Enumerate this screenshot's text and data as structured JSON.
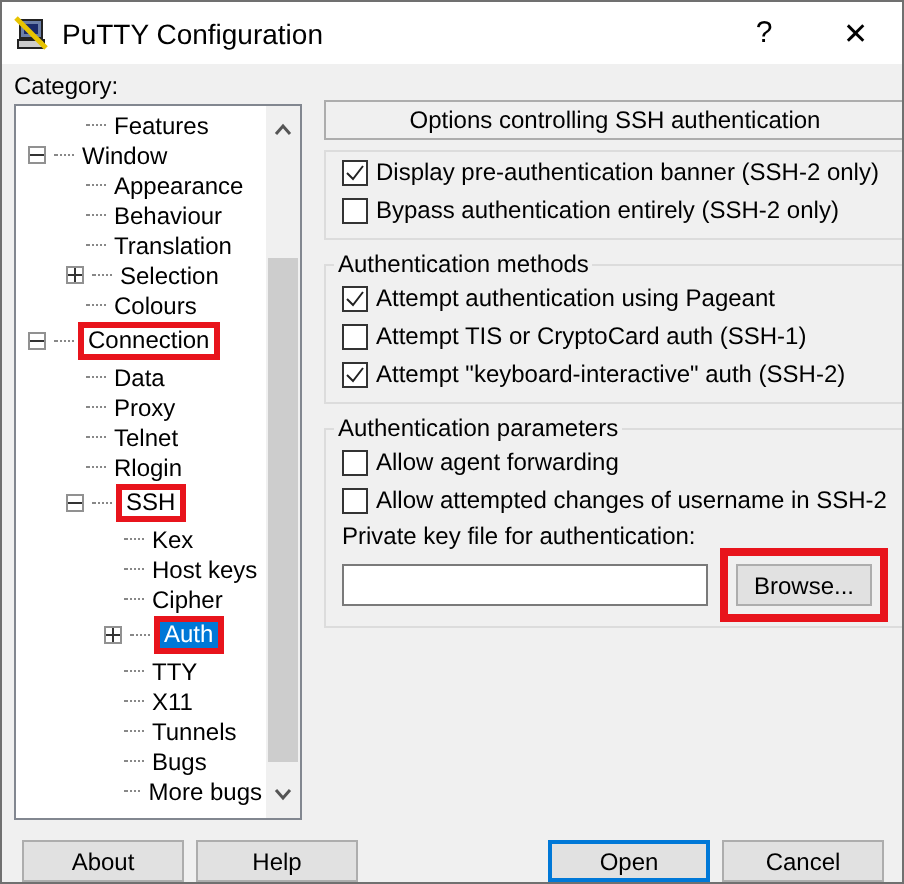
{
  "window": {
    "title": "PuTTY Configuration",
    "buttons": [
      "?",
      "✕"
    ]
  },
  "category": {
    "label": "Category:",
    "tree": [
      {
        "children": [
          {
            "label": "Features"
          }
        ]
      },
      {
        "label": "Window",
        "expanded": true,
        "children": [
          {
            "label": "Appearance"
          },
          {
            "label": "Behaviour"
          },
          {
            "label": "Translation"
          },
          {
            "label": "Selection",
            "expanded": false
          },
          {
            "label": "Colours"
          }
        ]
      },
      {
        "label": "Connection",
        "expanded": true,
        "highlighted": true,
        "children": [
          {
            "label": "Data"
          },
          {
            "label": "Proxy"
          },
          {
            "label": "Telnet"
          },
          {
            "label": "Rlogin"
          },
          {
            "label": "SSH",
            "expanded": true,
            "highlighted": true,
            "children": [
              {
                "label": "Kex"
              },
              {
                "label": "Host keys"
              },
              {
                "label": "Cipher"
              },
              {
                "label": "Auth",
                "expanded": false,
                "selected": true,
                "highlighted": true
              },
              {
                "label": "TTY"
              },
              {
                "label": "X11"
              },
              {
                "label": "Tunnels"
              },
              {
                "label": "Bugs"
              },
              {
                "label": "More bugs"
              }
            ]
          }
        ]
      }
    ]
  },
  "panel": {
    "header": "Options controlling SSH authentication",
    "groups": [
      {
        "options": [
          {
            "label": "Display pre-authentication banner (SSH-2 only)",
            "checked": true
          },
          {
            "label": "Bypass authentication entirely (SSH-2 only)",
            "checked": false
          }
        ]
      },
      {
        "title": "Authentication methods",
        "options": [
          {
            "label": "Attempt authentication using Pageant",
            "checked": true
          },
          {
            "label": "Attempt TIS or CryptoCard auth (SSH-1)",
            "checked": false
          },
          {
            "label": "Attempt \"keyboard-interactive\" auth (SSH-2)",
            "checked": true
          }
        ]
      },
      {
        "title": "Authentication parameters",
        "options": [
          {
            "label": "Allow agent forwarding",
            "checked": false
          },
          {
            "label": "Allow attempted changes of username in SSH-2",
            "checked": false
          }
        ],
        "file": {
          "label": "Private key file for authentication:",
          "button": {
            "label": "Browse...",
            "highlighted": true
          }
        }
      }
    ]
  },
  "buttons": [
    {
      "label": "About",
      "default": false
    },
    {
      "label": "Help",
      "default": false
    },
    {
      "label": "Open",
      "default": true
    },
    {
      "label": "Cancel",
      "default": false
    }
  ]
}
